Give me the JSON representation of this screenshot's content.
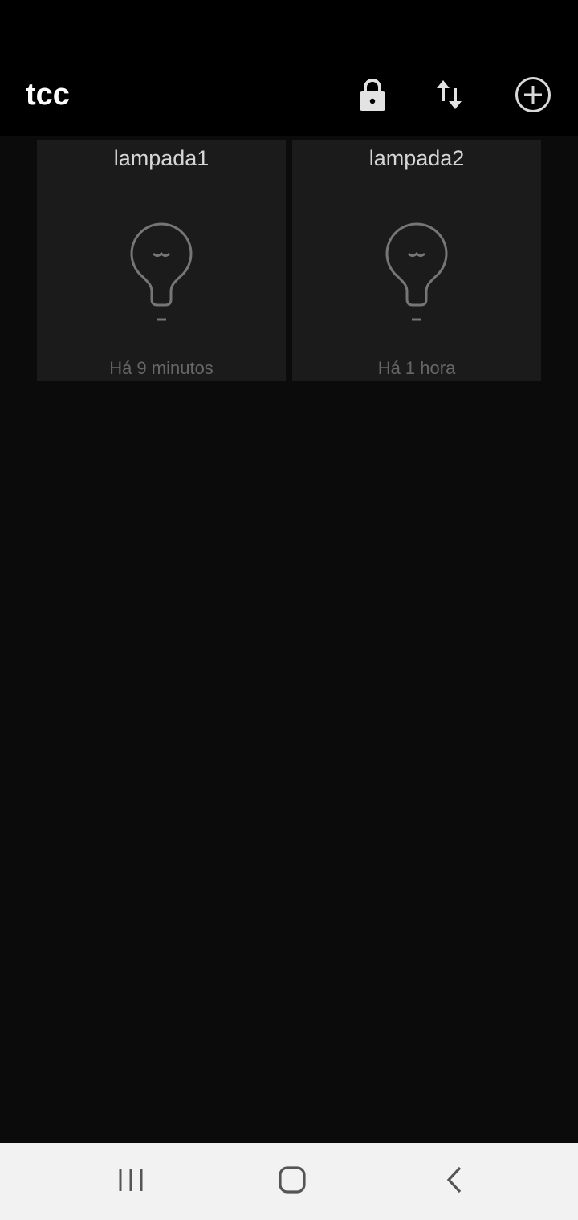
{
  "app_bar": {
    "title": "tcc",
    "actions": [
      {
        "name": "lock",
        "icon": "lock-icon"
      },
      {
        "name": "sort",
        "icon": "swap-vertical-icon"
      },
      {
        "name": "add",
        "icon": "add-circle-icon"
      }
    ]
  },
  "tiles": [
    {
      "name": "lampada1",
      "time": "Há 9 minutos",
      "icon": "lightbulb-icon",
      "state": "–"
    },
    {
      "name": "lampada2",
      "time": "Há 1 hora",
      "icon": "lightbulb-icon",
      "state": "–"
    }
  ],
  "nav_bar": {
    "buttons": [
      {
        "name": "recents",
        "icon": "recents-icon"
      },
      {
        "name": "home",
        "icon": "home-icon"
      },
      {
        "name": "back",
        "icon": "back-icon"
      }
    ]
  },
  "colors": {
    "background": "#0b0b0b",
    "app_bar": "#000000",
    "tile": "#1b1b1b",
    "tile_name": "#d6d6d6",
    "tile_time": "#676767",
    "icon_stroke": "#767676",
    "nav_bar": "#f2f2f2"
  }
}
